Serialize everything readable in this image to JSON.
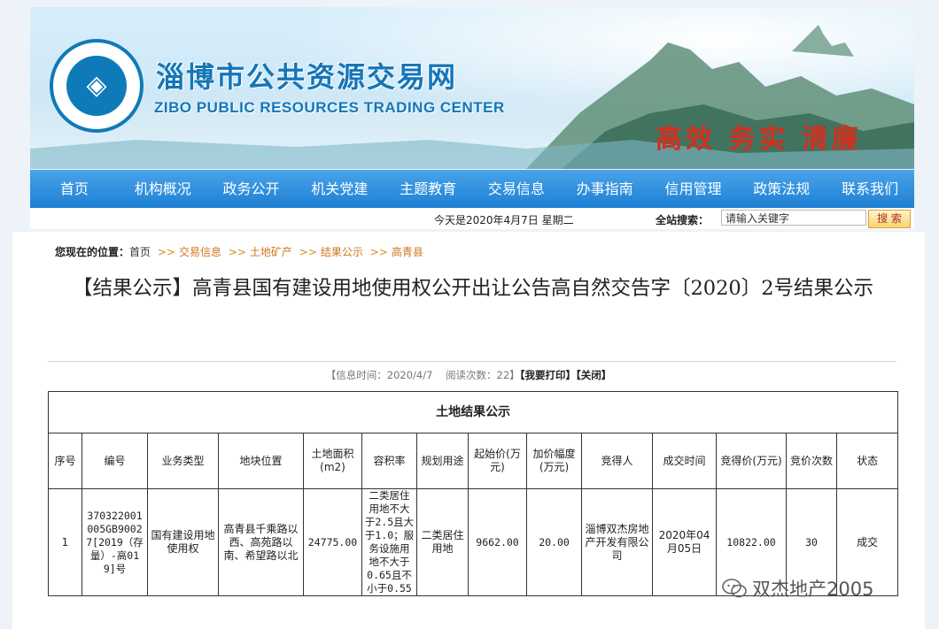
{
  "header": {
    "site_title": "淄博市公共资源交易网",
    "site_subtitle": "ZIBO PUBLIC RESOURCES TRADING CENTER",
    "motto": "高效 务实 清廉",
    "logo_icon": "zibo-trading-center-seal"
  },
  "nav": {
    "items": [
      "首页",
      "机构概况",
      "政务公开",
      "机关党建",
      "主题教育",
      "交易信息",
      "办事指南",
      "信用管理",
      "政策法规",
      "联系我们"
    ]
  },
  "infobar": {
    "today": "今天是2020年4月7日 星期二",
    "search_label": "全站搜索：",
    "search_value": "请输入关键字",
    "search_button": "搜 索"
  },
  "breadcrumb": {
    "here_label": "您现在的位置：",
    "home": "首页",
    "items": [
      "交易信息",
      "土地矿产",
      "结果公示",
      "高青县"
    ],
    "separator": ">>"
  },
  "article": {
    "title": "【结果公示】高青县国有建设用地使用权公开出让公告高自然交告字〔2020〕2号结果公示",
    "meta_time": "【信息时间：2020/4/7",
    "meta_reads": "阅读次数：22】",
    "print_label": "【我要打印】",
    "close_label": "【关闭】"
  },
  "table": {
    "caption": "土地结果公示",
    "headers": [
      "序号",
      "编号",
      "业务类型",
      "地块位置",
      "土地面积(m2)",
      "容积率",
      "规划用途",
      "起始价(万元)",
      "加价幅度(万元)",
      "竞得人",
      "成交时间",
      "竞得价(万元)",
      "竞价次数",
      "状态"
    ],
    "rows": [
      [
        "1",
        "370322001005GB90027[2019（存量）-高019]号",
        "国有建设用地使用权",
        "高青县千乘路以西、高苑路以南、希望路以北",
        "24775.00",
        "二类居住用地不大于2.5且大于1.0；服务设施用地不大于0.65且不小于0.55",
        "二类居住用地",
        "9662.00",
        "20.00",
        "淄博双杰房地产开发有限公司",
        "2020年04月05日",
        "10822.00",
        "30",
        "成交"
      ]
    ]
  },
  "watermark": {
    "text": "双杰地产2005",
    "icon": "wechat-icon"
  },
  "colors": {
    "nav_blue": "#1d80d4",
    "brand_blue": "#1576b8",
    "motto_red": "#d42e1e",
    "crumb_orange": "#d0761c"
  }
}
